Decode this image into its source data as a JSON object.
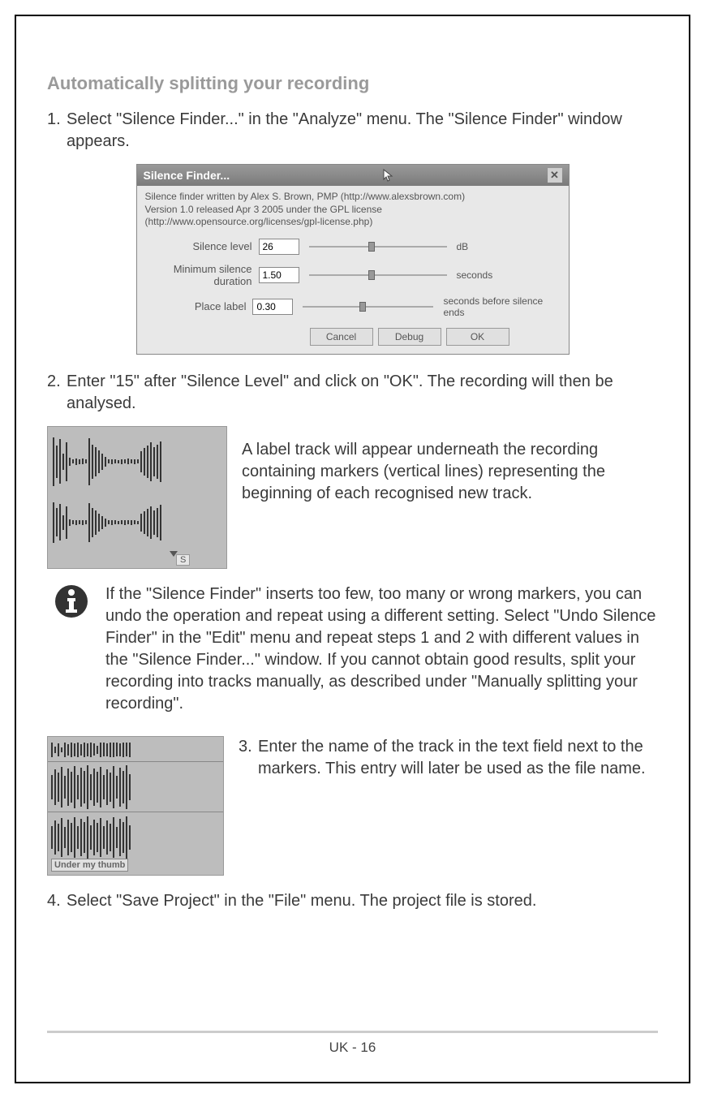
{
  "heading": "Automatically splitting your recording",
  "step1": {
    "num": "1.",
    "text": "Select \"Silence Finder...\" in the \"Analyze\" menu. The \"Silence Finder\" window appears."
  },
  "dialog": {
    "title": "Silence Finder...",
    "desc_line1": "Silence finder written by Alex S. Brown, PMP (http://www.alexsbrown.com)",
    "desc_line2": "Version 1.0 released Apr 3 2005 under the GPL license",
    "desc_line3": "(http://www.opensource.org/licenses/gpl-license.php)",
    "params": [
      {
        "label": "Silence level",
        "value": "26",
        "unit": "dB"
      },
      {
        "label": "Minimum silence duration",
        "value": "1.50",
        "unit": "seconds"
      },
      {
        "label": "Place label",
        "value": "0.30",
        "unit": "seconds before silence ends"
      }
    ],
    "buttons": {
      "cancel": "Cancel",
      "debug": "Debug",
      "ok": "OK"
    }
  },
  "step2": {
    "num": "2.",
    "text": "Enter \"15\" after \"Silence Level\" and click on \"OK\". The recording will then be analysed."
  },
  "illus1_label": "S",
  "ptext1": "A label track will appear underneath the recording containing markers (vertical lines) representing the beginning of each recognised new track.",
  "info": "If the \"Silence Finder\" inserts too few, too many or wrong markers, you can undo the operation and repeat using a different setting. Select \"Undo Silence Finder\" in the \"Edit\" menu and repeat steps 1 and 2 with different values in the \"Silence Finder...\" window. If you cannot obtain good results, split your recording into tracks manually, as described under \"Manually splitting your recording\".",
  "step3": {
    "num": "3.",
    "text": "Enter the name of the track in the text field next to the markers. This entry will later be used as the file name."
  },
  "illus2_input": "Under my thumb",
  "step4": {
    "num": "4.",
    "text": "Select \"Save Project\" in the \"File\" menu. The project file is stored."
  },
  "footer": "UK - 16"
}
